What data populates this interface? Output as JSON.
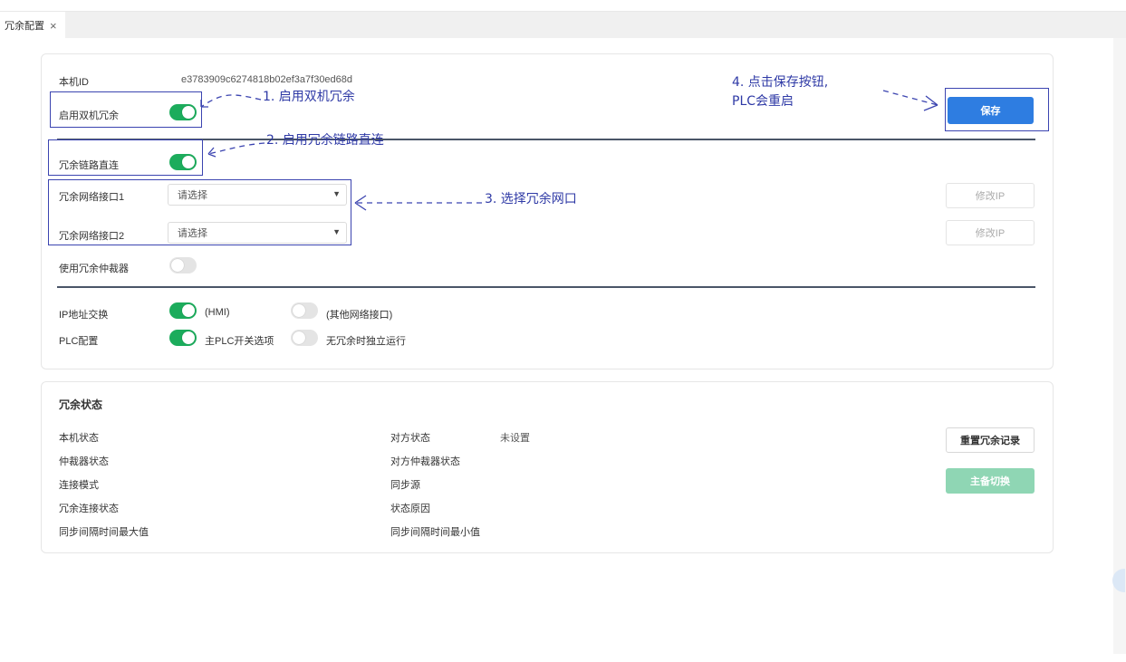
{
  "tab": {
    "title": "冗余配置",
    "close": "×"
  },
  "config": {
    "device_id_label": "本机ID",
    "device_id_value": "e3783909c6274818b02ef3a7f30ed68d",
    "enable_dual_label": "启用双机冗余",
    "enable_dual_on": true,
    "direct_link_label": "冗余链路直连",
    "direct_link_on": true,
    "net_if1_label": "冗余网络接口1",
    "net_if1_value": "请选择",
    "net_if2_label": "冗余网络接口2",
    "net_if2_value": "请选择",
    "arbiter_label": "使用冗余仲裁器",
    "arbiter_on": false,
    "ip_swap_label": "IP地址交换",
    "ip_swap_hmi_label": "(HMI)",
    "ip_swap_other_label": "(其他网络接口)",
    "plc_label": "PLC配置",
    "plc_master_label": "主PLC开关选项",
    "plc_standalone_label": "无冗余时独立运行",
    "save_label": "保存",
    "modify_ip_label": "修改IP"
  },
  "status": {
    "title": "冗余状态",
    "local_state": "本机状态",
    "arbiter_state": "仲裁器状态",
    "conn_mode": "连接模式",
    "redundancy_conn_state": "冗余连接状态",
    "sync_max": "同步间隔时间最大值",
    "peer_state": "对方状态",
    "peer_state_value": "未设置",
    "peer_arbiter_state": "对方仲裁器状态",
    "sync_source": "同步源",
    "state_reason": "状态原因",
    "sync_min": "同步间隔时间最小值",
    "reset_button": "重置冗余记录",
    "switch_button": "主备切换"
  },
  "annotations": {
    "step1": "1. 启用双机冗余",
    "step2": "2. 启用冗余链路直连",
    "step3": "3. 选择冗余网口",
    "step4_line1": "4. 点击保存按钮,",
    "step4_line2": "PLC会重启"
  },
  "colors": {
    "toggle_on": "#1cac5c",
    "toggle_off": "#e4e4e4",
    "primary": "#2e7de1",
    "annotation": "#2f3aa6",
    "switch_button": "#8fd6b4"
  }
}
